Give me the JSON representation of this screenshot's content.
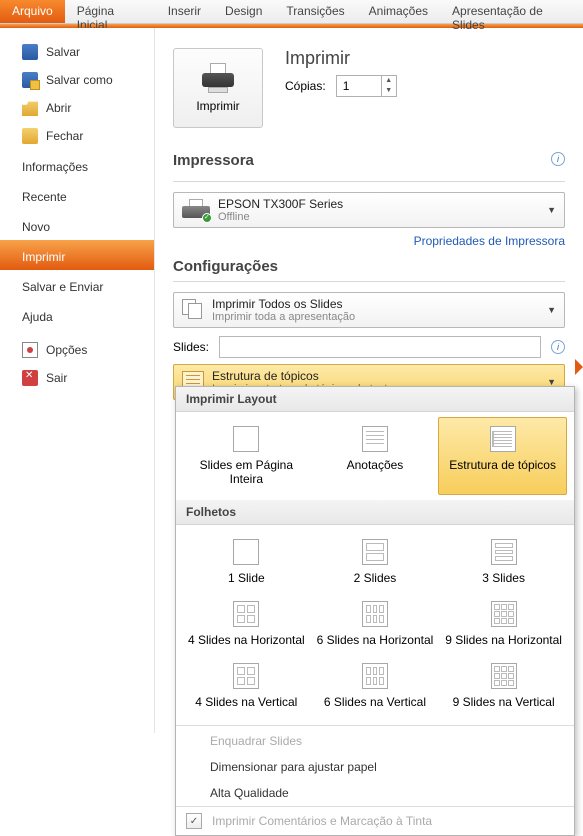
{
  "ribbon": {
    "tabs": [
      "Arquivo",
      "Página Inicial",
      "Inserir",
      "Design",
      "Transições",
      "Animações",
      "Apresentação de Slides"
    ],
    "active": 0
  },
  "sidebar": {
    "items": [
      {
        "id": "salvar",
        "label": "Salvar",
        "icon": "save-icon"
      },
      {
        "id": "salvar-como",
        "label": "Salvar como",
        "icon": "save-as-icon"
      },
      {
        "id": "abrir",
        "label": "Abrir",
        "icon": "open-icon"
      },
      {
        "id": "fechar",
        "label": "Fechar",
        "icon": "close-file-icon"
      }
    ],
    "sections": [
      "Informações",
      "Recente",
      "Novo",
      "Imprimir",
      "Salvar e Enviar",
      "Ajuda"
    ],
    "active_section": 3,
    "footer": [
      {
        "id": "opcoes",
        "label": "Opções",
        "icon": "options-icon"
      },
      {
        "id": "sair",
        "label": "Sair",
        "icon": "exit-icon"
      }
    ]
  },
  "print": {
    "button_label": "Imprimir",
    "heading": "Imprimir",
    "copies_label": "Cópias:",
    "copies_value": "1"
  },
  "printer": {
    "heading": "Impressora",
    "name": "EPSON TX300F Series",
    "status": "Offline",
    "properties_link": "Propriedades de Impressora"
  },
  "settings": {
    "heading": "Configurações",
    "what": {
      "title": "Imprimir Todos os Slides",
      "sub": "Imprimir toda a apresentação"
    },
    "slides_label": "Slides:",
    "layout": {
      "title": "Estrutura de tópicos",
      "sub": "Imprimir estrutura de tópicos do texto"
    }
  },
  "flyout": {
    "h_layout": "Imprimir Layout",
    "layout_opts": [
      "Slides em Página Inteira",
      "Anotações",
      "Estrutura de tópicos"
    ],
    "h_handouts": "Folhetos",
    "handouts": [
      "1 Slide",
      "2 Slides",
      "3 Slides",
      "4 Slides na Horizontal",
      "6 Slides na Horizontal",
      "9 Slides na Horizontal",
      "4 Slides na Vertical",
      "6 Slides na Vertical",
      "9 Slides na Vertical"
    ],
    "extra": [
      "Enquadrar Slides",
      "Dimensionar para ajustar papel",
      "Alta Qualidade"
    ],
    "extra_disabled": [
      true,
      false,
      false
    ],
    "check_label": "Imprimir Comentários e Marcação à Tinta",
    "check_checked": true
  }
}
